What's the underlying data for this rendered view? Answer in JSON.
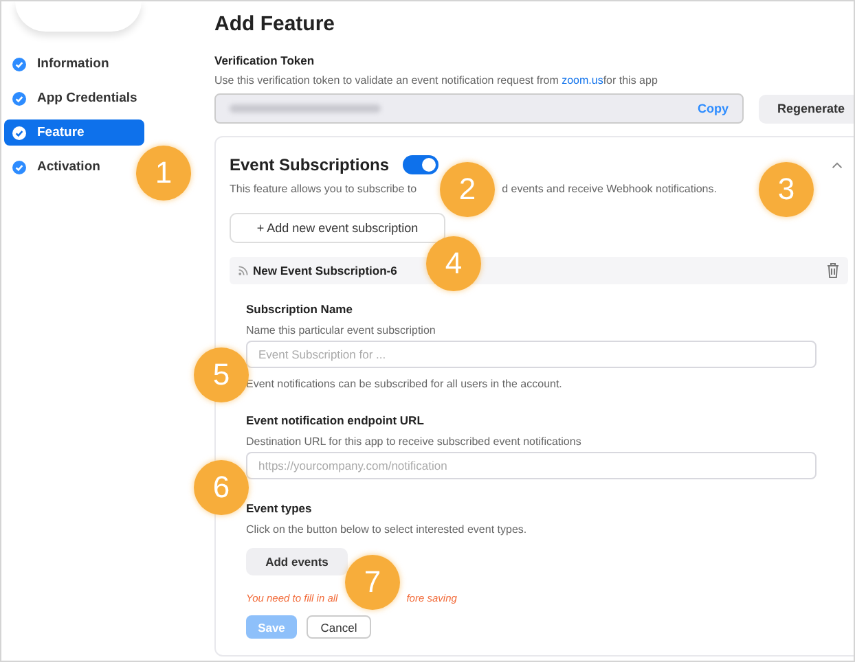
{
  "sidebar": {
    "items": [
      {
        "label": "Information",
        "selected": false
      },
      {
        "label": "App Credentials",
        "selected": false
      },
      {
        "label": "Feature",
        "selected": true
      },
      {
        "label": "Activation",
        "selected": false
      }
    ]
  },
  "title": "Add Feature",
  "verification_token": {
    "label": "Verification Token",
    "description_before": "Use this verification token to validate an event notification request from ",
    "link": "zoom.us",
    "description_after": "for this app",
    "copy_label": "Copy",
    "regenerate_label": "Regenerate"
  },
  "event_subscriptions": {
    "title": "Event Subscriptions",
    "on": true,
    "expanded": true,
    "description_parts": [
      "This feature allows you to subscribe to",
      "d events and receive Webhook notifications."
    ],
    "add_label": "+ Add new event subscription",
    "subscription": {
      "name": "New Event Subscription-6",
      "fields": [
        {
          "label": "Subscription Name",
          "description": "Name this particular event subscription",
          "placeholder": "Event Subscription for ...",
          "note": "Event notifications can be subscribed for all users in the account."
        },
        {
          "label": "Event notification endpoint URL",
          "description": "Destination URL for this app to receive subscribed event notifications",
          "placeholder": "https://yourcompany.com/notification"
        }
      ],
      "event_types": {
        "label": "Event types",
        "description": "Click on the button below to select interested event types.",
        "button": "Add events"
      },
      "error_parts": [
        "You need to fill in all",
        "fore saving"
      ],
      "save": {
        "label": "Save",
        "disabled": true
      },
      "cancel": "Cancel"
    }
  },
  "callouts": [
    "1",
    "2",
    "3",
    "4",
    "5",
    "6",
    "7"
  ]
}
